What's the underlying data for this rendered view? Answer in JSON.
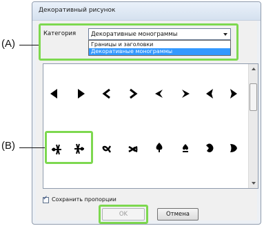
{
  "dialog": {
    "title": "Декоративный рисунок",
    "category_label": "Категория",
    "category_selected": "Декоративные монограммы",
    "options": [
      "Границы и заголовки",
      "Декоративные монограммы"
    ],
    "keep_proportions_label": "Сохранить пропорции",
    "keep_proportions_checked": true,
    "ok_label": "OK",
    "ok_enabled": false,
    "cancel_label": "Отмена"
  },
  "glyph_rows": [
    [
      "left-triangle",
      "right-triangle",
      "left-chevron",
      "right-chevron",
      "left-notched",
      "right-notched",
      "left-swirl",
      "right-swirl"
    ],
    [
      "left-ornament",
      "right-ornament",
      "alpha-knot",
      "x-knot",
      "spade",
      "spade-small",
      "flower",
      "leaf"
    ]
  ],
  "annotations": {
    "a_label": "(A)",
    "b_label": "(B)"
  },
  "colors": {
    "highlight": "#7dd84f",
    "selection": "#3399ff"
  }
}
